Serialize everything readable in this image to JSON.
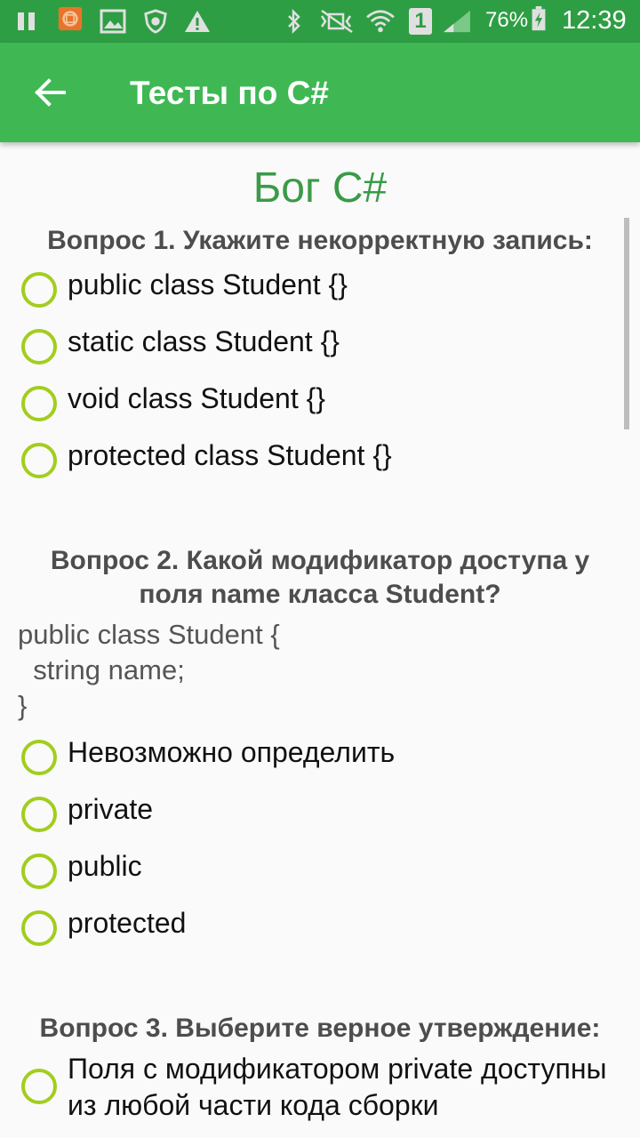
{
  "status_bar": {
    "battery_percent": "76%",
    "time": "12:39",
    "sim_number": "1"
  },
  "toolbar": {
    "title": "Тесты по C#"
  },
  "test": {
    "title": "Бог C#",
    "questions": [
      {
        "title": "Вопрос 1. Укажите некорректную запись:",
        "options": [
          "public class Student {}",
          "static class Student {}",
          "void class Student {}",
          "protected class Student {}"
        ]
      },
      {
        "title_line1": "Вопрос 2. Какой модификатор доступа у",
        "title_line2": "поля name класса Student?",
        "code": [
          "public class Student {",
          "  string name;",
          "}"
        ],
        "options": [
          "Невозможно определить",
          "private",
          "public",
          "protected"
        ]
      },
      {
        "title": "Вопрос 3. Выберите верное утверждение:",
        "options": [
          "Поля с модификатором private доступны из любой части кода сборки"
        ]
      }
    ]
  },
  "colors": {
    "status_bar": "#2e9e44",
    "toolbar": "#3fb854",
    "accent_title": "#3a9a48",
    "radio": "#a3cd1e"
  }
}
